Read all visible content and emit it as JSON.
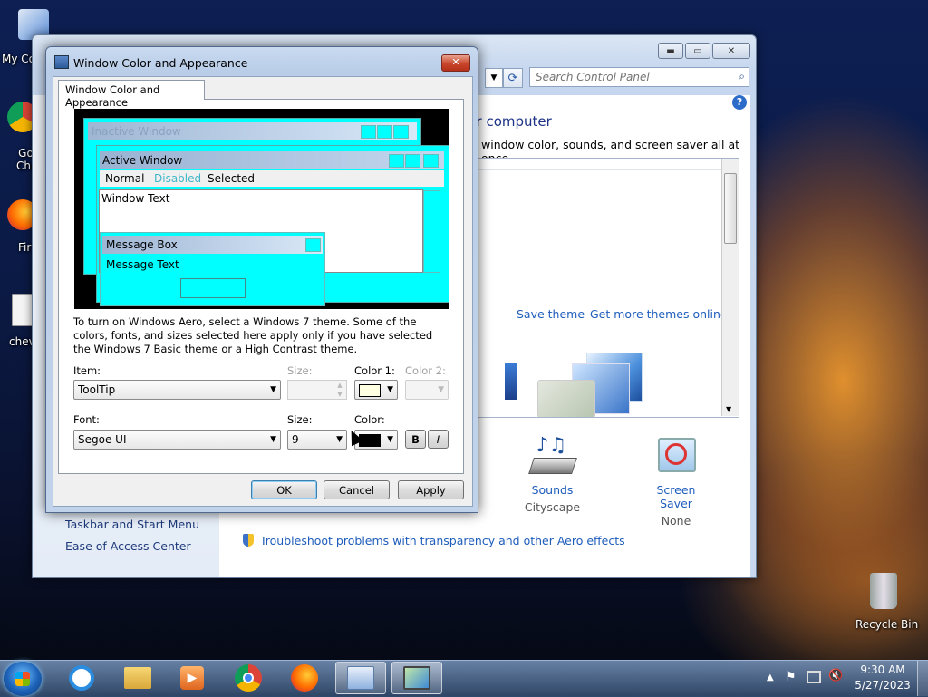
{
  "desktop": {
    "icons": [
      {
        "label": "My Co",
        "name": "computer-desktop-icon"
      },
      {
        "label": "Go\nChr",
        "name": "chrome-desktop-icon"
      },
      {
        "label": "Fir",
        "name": "firefox-desktop-icon"
      },
      {
        "label": "chev",
        "name": "file-desktop-icon"
      },
      {
        "label": "Recycle Bin",
        "name": "recycle-bin-icon"
      }
    ]
  },
  "control_panel": {
    "search_placeholder": "Search Control Panel",
    "heading": "ur computer",
    "subheading": "window color, sounds, and screen saver all at once.",
    "save_theme": "Save theme",
    "get_more_themes": "Get more themes online",
    "sidebar": [
      "Taskbar and Start Menu",
      "Ease of Access Center"
    ],
    "troubleshoot": "Troubleshoot problems with transparency and other Aero effects",
    "sounds_label": "Sounds",
    "sounds_value": "Cityscape",
    "screensaver_label": "Screen Saver",
    "screensaver_value": "None"
  },
  "dialog": {
    "title": "Window Color and Appearance",
    "tab": "Window Color and Appearance",
    "preview": {
      "inactive": "Inactive Window",
      "active": "Active Window",
      "menu_normal": "Normal",
      "menu_disabled": "Disabled",
      "menu_selected": "Selected",
      "window_text": "Window Text",
      "message_box": "Message Box",
      "message_text": "Message Text"
    },
    "info": "To turn on Windows Aero, select a Windows 7 theme.  Some of the colors, fonts, and sizes selected here apply only if you have selected the Windows 7 Basic theme or a High Contrast theme.",
    "item_label": "Item:",
    "item_value": "ToolTip",
    "size_label": "Size:",
    "color1_label": "Color 1:",
    "color2_label": "Color 2:",
    "font_label": "Font:",
    "font_value": "Segoe UI",
    "font_size_label": "Size:",
    "font_size_value": "9",
    "font_color_label": "Color:",
    "bold": "B",
    "italic": "I",
    "ok": "OK",
    "cancel": "Cancel",
    "apply": "Apply",
    "colors": {
      "color1": "#ffffe1",
      "font_color": "#000000",
      "preview_accent": "#00ffff"
    }
  },
  "taskbar": {
    "time": "9:30 AM",
    "date": "5/27/2023",
    "apps": [
      "internet-explorer-icon",
      "file-explorer-icon",
      "media-player-icon",
      "chrome-icon",
      "firefox-icon",
      "control-panel-icon",
      "display-settings-icon"
    ]
  }
}
